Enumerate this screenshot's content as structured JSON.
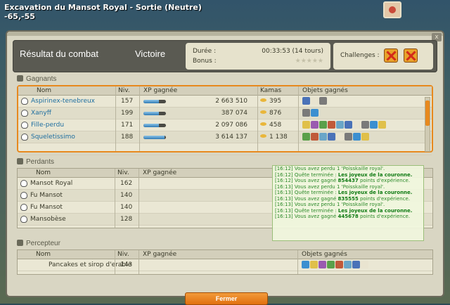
{
  "map": {
    "title": "Excavation du Mansot Royal - Sortie (Neutre)",
    "coords": "-65,-55"
  },
  "header": {
    "title": "Résultat du combat",
    "outcome": "Victoire",
    "duration_label": "Durée :",
    "duration_value": "00:33:53 (14 tours)",
    "bonus_label": "Bonus :",
    "challenges_label": "Challenges :",
    "close": "x"
  },
  "columns": {
    "name": "Nom",
    "level": "Niv.",
    "xp": "XP gagnée",
    "kamas": "Kamas",
    "items": "Objets gagnés"
  },
  "winners": {
    "label": "Gagnants",
    "rows": [
      {
        "name": "Aspirinex-tenebreux",
        "level": "157",
        "xp": "2 663 510",
        "xp_fill": 0.7,
        "kamas": "395"
      },
      {
        "name": "Xanyff",
        "level": "199",
        "xp": "387 074",
        "xp_fill": 0.7,
        "kamas": "876"
      },
      {
        "name": "Fille-perdu",
        "level": "171",
        "xp": "2 097 086",
        "xp_fill": 0.7,
        "kamas": "458"
      },
      {
        "name": "Squeletissimo",
        "level": "188",
        "xp": "3 614 137",
        "xp_fill": 0.95,
        "kamas": "1 138"
      }
    ]
  },
  "losers": {
    "label": "Perdants",
    "rows": [
      {
        "name": "Mansot Royal",
        "level": "162"
      },
      {
        "name": "Fu Mansot",
        "level": "140"
      },
      {
        "name": "Fu Mansot",
        "level": "140"
      },
      {
        "name": "Mansobèse",
        "level": "128"
      }
    ]
  },
  "collector": {
    "label": "Percepteur",
    "rows": [
      {
        "name": "Pancakes et sirop d'erable",
        "level": "143"
      }
    ]
  },
  "chat": [
    {
      "time": "[16:12]",
      "text": "Vous avez perdu 1 'Poisskaille royal'."
    },
    {
      "time": "[16:12]",
      "text": "Quête terminée : ",
      "bold": "Les joyeux de la couronne."
    },
    {
      "time": "[16:12]",
      "text": "Vous avez gagné ",
      "bold": "854437",
      "after": " points d'expérience."
    },
    {
      "time": "[16:13]",
      "text": "Vous avez perdu 1 'Poisskaille royal'."
    },
    {
      "time": "[16:13]",
      "text": "Quête terminée : ",
      "bold": "Les joyeux de la couronne."
    },
    {
      "time": "[16:13]",
      "text": "Vous avez gagné ",
      "bold": "835555",
      "after": " points d'expérience."
    },
    {
      "time": "[16:13]",
      "text": "Vous avez perdu 1 'Poisskaille royal'."
    },
    {
      "time": "[16:13]",
      "text": "Quête terminée : ",
      "bold": "Les joyeux de la couronne."
    },
    {
      "time": "[16:13]",
      "text": "Vous avez gagné ",
      "bold": "445678",
      "after": " points d'expérience."
    }
  ],
  "close_button": "Fermer"
}
